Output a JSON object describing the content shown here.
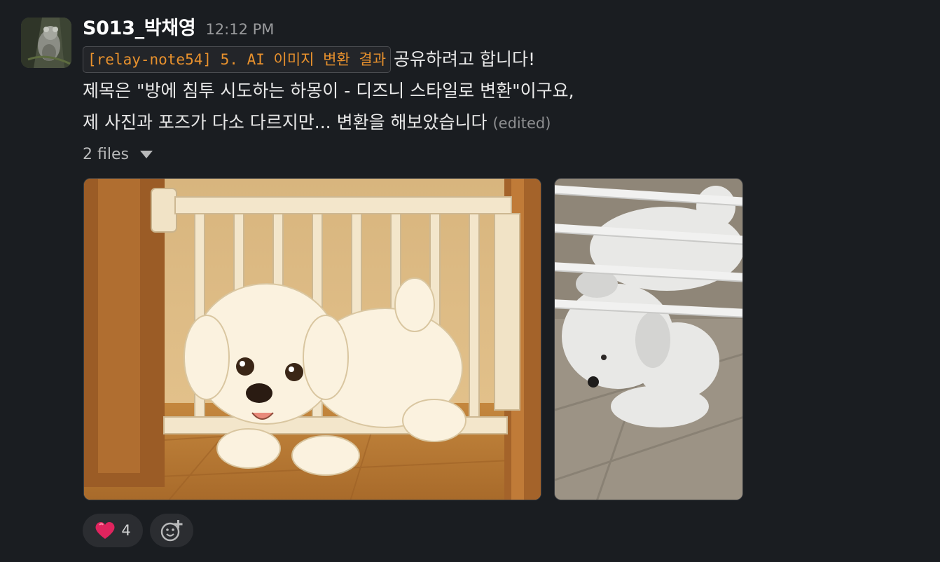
{
  "message": {
    "username": "S013_박채영",
    "timestamp": "12:12 PM",
    "code_chip": "[relay-note54] 5. AI 이미지 변환 결과",
    "line1_rest": "공유하려고 합니다!",
    "line2": "제목은 \"방에 침투 시도하는 하몽이 - 디즈니 스타일로 변환\"이구요,",
    "line3": "제 사진과 포즈가 다소 다르지만... 변환을 해보았습니다",
    "edited": "(edited)"
  },
  "files": {
    "label": "2 files",
    "items": [
      {
        "icon": "cartoon-puppy-image"
      },
      {
        "icon": "photo-puppy-image"
      }
    ]
  },
  "reactions": [
    {
      "emoji": "heart-icon",
      "count": "4",
      "color": "#e0245e"
    },
    {
      "emoji": "add-reaction-icon"
    }
  ],
  "colors": {
    "background": "#1a1d21",
    "code_text": "#e8912d",
    "username": "#ffffff"
  }
}
